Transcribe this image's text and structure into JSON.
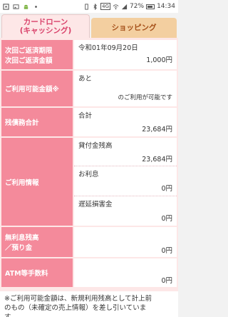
{
  "status_bar": {
    "time": "14:34",
    "battery": "72%",
    "network": "4G",
    "icons": [
      "notification-icon",
      "image-icon",
      "android-icon",
      "vibrate-icon",
      "wifi-icon",
      "signal-icon",
      "battery-icon"
    ]
  },
  "tabs": {
    "card_loan_line1": "カードローン",
    "card_loan_line2": "(キャッシング)",
    "shopping": "ショッピング"
  },
  "rows": {
    "next_payment": {
      "label_line1": "次回ご返済期限",
      "label_line2": "次回ご返済金額",
      "date": "令和01年09月20日",
      "amount": "1,000円"
    },
    "available": {
      "label": "ご利用可能金額※",
      "prefix": "あと",
      "suffix": "のご利用が可能です"
    },
    "total_debt": {
      "label": "残債務合計",
      "sub_label": "合計",
      "value": "23,684円"
    },
    "usage_info": {
      "label": "ご利用情報",
      "items": [
        {
          "label": "貸付金残高",
          "value": "23,684円"
        },
        {
          "label": "お利息",
          "value": "0円"
        },
        {
          "label": "遅延損害金",
          "value": "0円"
        }
      ]
    },
    "interest_free": {
      "label_line1": "無利息残高",
      "label_line2": "／預り金",
      "value": "0円"
    },
    "atm_fee": {
      "label": "ATM等手数料",
      "value": "0円"
    }
  },
  "footer": {
    "line1": "※ご利用可能金額は、新規利用残高として計上前",
    "line2": "のもの（未確定の売上情報）を差し引いていま",
    "line3": "す。"
  },
  "colors": {
    "header_pink": "#f48a9b",
    "bg_pink": "#fde7e7",
    "tab_active_text": "#d9416a",
    "tab_shopping_bg": "#f3cfa0",
    "tab_shopping_text": "#a44f18"
  }
}
